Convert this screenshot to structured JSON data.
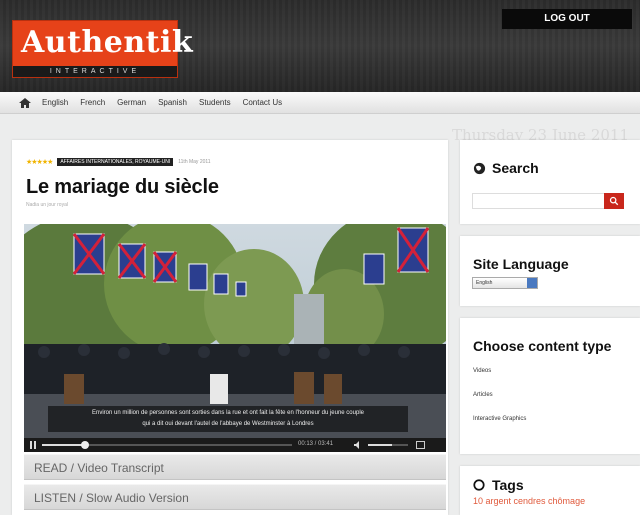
{
  "header": {
    "logo_main": "Authentik",
    "logo_sub": "INTERACTIVE",
    "logout_label": "LOG OUT"
  },
  "nav": {
    "home_icon": "home-icon",
    "items": [
      "English",
      "French",
      "German",
      "Spanish",
      "Students",
      "Contact Us"
    ]
  },
  "date": "Thursday 23 June 2011",
  "article": {
    "rating_stars": "★★★★★",
    "tag": "AFFAIRES INTERNATIONALES, ROYAUME-UNI",
    "published": "11th May 2011",
    "title": "Le mariage du siècle",
    "byline": "Nadia un jour royal",
    "video": {
      "subtitle_line1": "Environ un million de personnes sont sorties dans la rue et ont fait la fête en l'honneur du jeune couple",
      "subtitle_line2": "qui a dit oui devant l'autel de l'abbaye de Westminster à Londres",
      "time": "00:13 / 03:41",
      "progress": 0.17,
      "volume": 0.6
    },
    "accordion": [
      "READ / Video Transcript",
      "LISTEN / Slow Audio Version"
    ]
  },
  "sidebar": {
    "search": {
      "title": "Search",
      "icon": "globe-icon",
      "placeholder": ""
    },
    "language": {
      "title": "Site Language",
      "selected": "English"
    },
    "content_type": {
      "title": "Choose content type",
      "items": [
        "Videos",
        "Articles",
        "Interactive Graphics"
      ]
    },
    "tags": {
      "title": "Tags",
      "icon": "circle-icon",
      "first_tag": "10 argent cendres chômage"
    }
  },
  "colors": {
    "brand_orange": "#e64219",
    "search_red": "#c9271c",
    "tag_link": "#e05a3c"
  }
}
